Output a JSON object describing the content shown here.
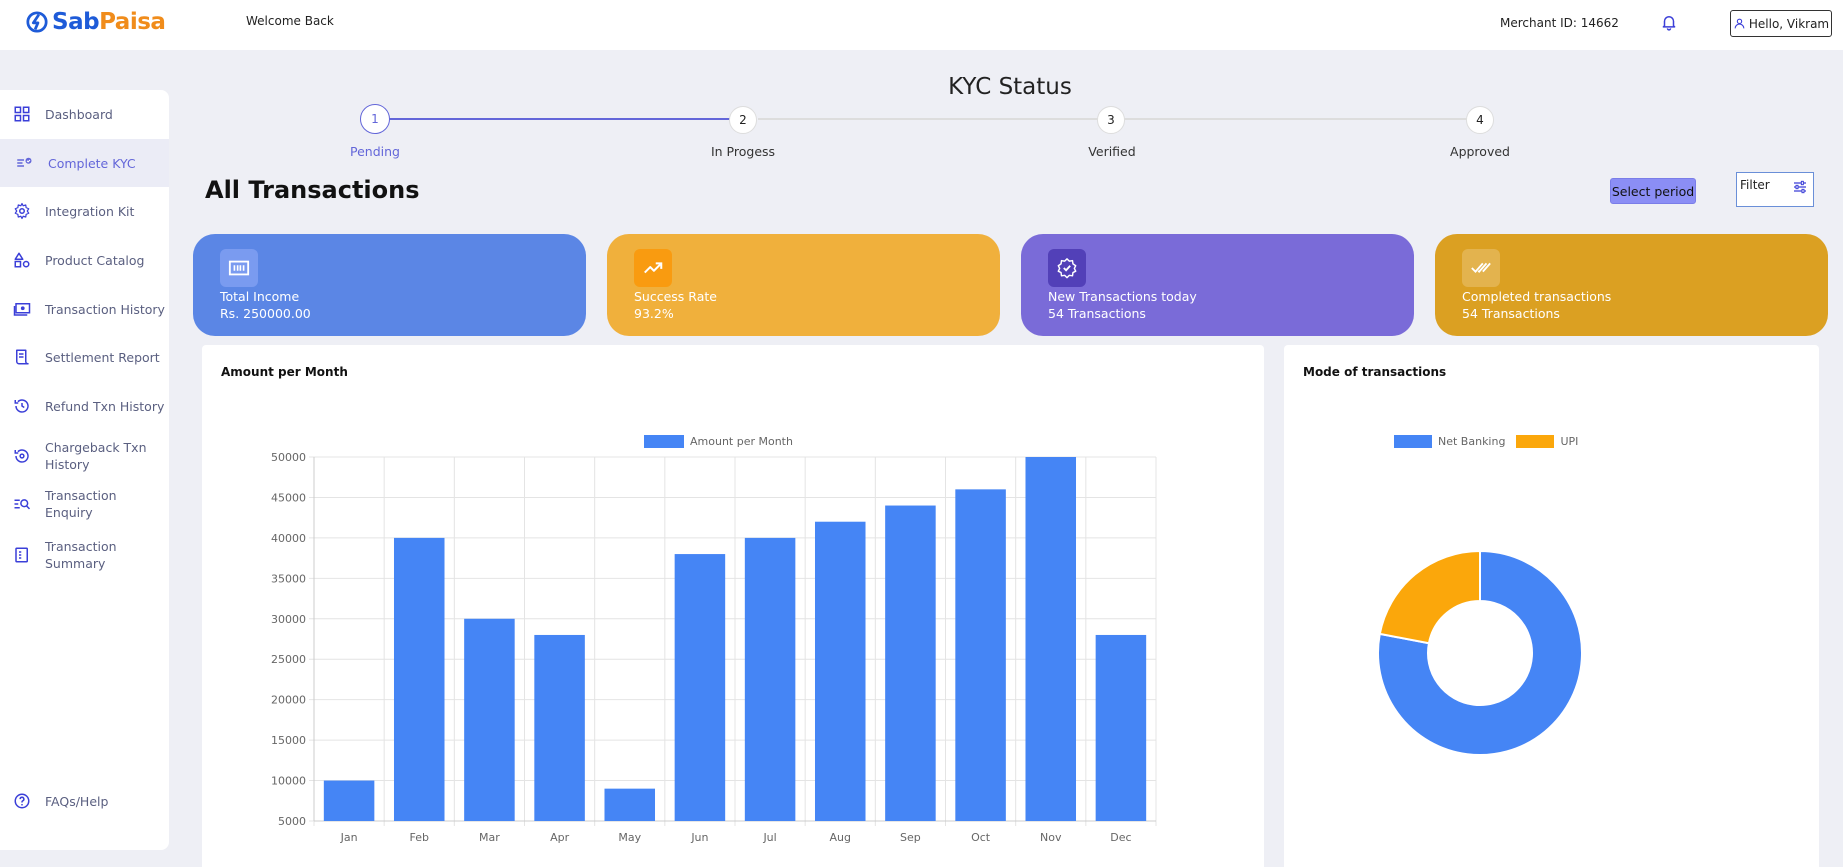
{
  "brand": {
    "sab": "Sab",
    "paisa": "Paisa"
  },
  "header": {
    "welcome": "Welcome Back",
    "merchant_id": "Merchant ID: 14662",
    "hello": "Hello, Vikram"
  },
  "sidebar": {
    "items": [
      {
        "label": "Dashboard",
        "icon": "grid-icon"
      },
      {
        "label": "Complete KYC",
        "icon": "kyc-icon",
        "active": true
      },
      {
        "label": "Integration Kit",
        "icon": "gear-icon"
      },
      {
        "label": "Product Catalog",
        "icon": "shapes-icon"
      },
      {
        "label": "Transaction History",
        "icon": "cash-icon"
      },
      {
        "label": "Settlement Report",
        "icon": "receipt-icon"
      },
      {
        "label": "Refund Txn History",
        "icon": "history-icon"
      },
      {
        "label": "Chargeback Txn History",
        "icon": "chargeback-icon"
      },
      {
        "label": "Transaction Enquiry",
        "icon": "search-list-icon"
      },
      {
        "label": "Transaction Summary",
        "icon": "summary-icon"
      }
    ],
    "help": "FAQs/Help"
  },
  "kyc": {
    "title": "KYC Status",
    "steps": [
      {
        "num": "1",
        "label": "Pending",
        "active": true
      },
      {
        "num": "2",
        "label": "In Progess"
      },
      {
        "num": "3",
        "label": "Verified"
      },
      {
        "num": "4",
        "label": "Approved"
      }
    ]
  },
  "transactions": {
    "title": "All Transactions",
    "select_period": "Select period",
    "filter": "Filter"
  },
  "cards": [
    {
      "title": "Total Income",
      "value": "Rs. 250000.00",
      "color": "#5b86e5",
      "icon": "money-icon"
    },
    {
      "title": "Success Rate",
      "value": "93.2%",
      "color": "#f0b03c",
      "icon": "trend-up-icon"
    },
    {
      "title": "New Transactions today",
      "value": "54 Transactions",
      "color": "#7a6bd8",
      "icon": "verified-badge-icon"
    },
    {
      "title": "Completed transactions",
      "value": "54 Transactions",
      "color": "#dba022",
      "icon": "double-check-icon"
    }
  ],
  "bar_panel": {
    "title": "Amount per Month"
  },
  "pie_panel": {
    "title": "Mode of transactions"
  },
  "chart_data": [
    {
      "type": "bar",
      "title": "Amount per Month",
      "categories": [
        "Jan",
        "Feb",
        "Mar",
        "Apr",
        "May",
        "Jun",
        "Jul",
        "Aug",
        "Sep",
        "Oct",
        "Nov",
        "Dec"
      ],
      "series": [
        {
          "name": "Amount per Month",
          "values": [
            10000,
            40000,
            30000,
            28000,
            9000,
            38000,
            40000,
            42000,
            44000,
            46000,
            50000,
            28000
          ],
          "color": "#4585f5"
        }
      ],
      "yticks": [
        "50000",
        "45000",
        "40000",
        "35000",
        "30000",
        "25000",
        "20000",
        "15000",
        "10000",
        "5000"
      ],
      "ylim": [
        5000,
        50000
      ],
      "grid": true,
      "legend": "top"
    },
    {
      "type": "pie",
      "title": "Mode of transactions",
      "variant": "doughnut",
      "labels": [
        "Net Banking",
        "UPI"
      ],
      "values": [
        78,
        22
      ],
      "colors": [
        "#4585f5",
        "#fba70b"
      ],
      "legend": "top"
    }
  ]
}
